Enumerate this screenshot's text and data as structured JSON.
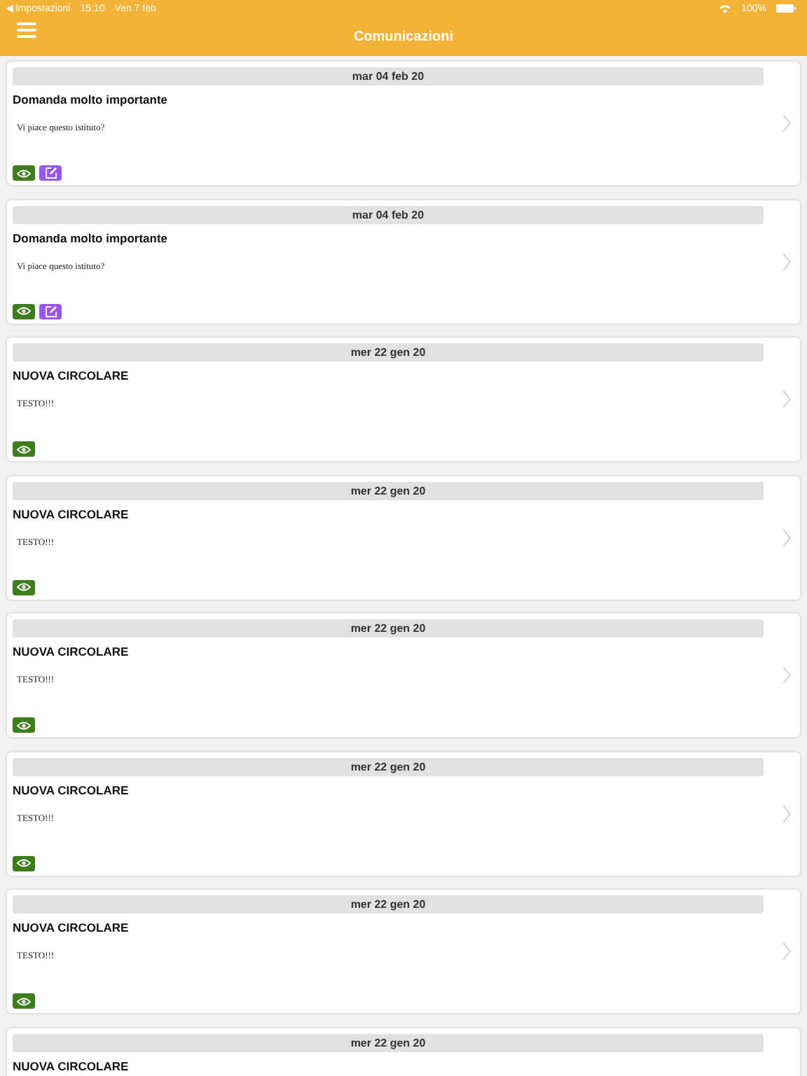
{
  "status_bar": {
    "back_label": "◀ Impostazioni",
    "time": "15:10",
    "date": "Ven 7 feb",
    "battery": "100%"
  },
  "header": {
    "title": "Comunicazioni"
  },
  "cards": [
    {
      "date": "mar 04 feb 20",
      "title": "Domanda molto importante",
      "body": "Vi piace questo istituto?",
      "actions": [
        {
          "kind": "view"
        },
        {
          "kind": "edit"
        }
      ]
    },
    {
      "date": "mar 04 feb 20",
      "title": "Domanda molto importante",
      "body": "Vi piace questo istituto?",
      "actions": [
        {
          "kind": "view"
        },
        {
          "kind": "edit"
        }
      ]
    },
    {
      "date": "mer 22 gen 20",
      "title": "NUOVA CIRCOLARE",
      "body": "TESTO!!!",
      "actions": [
        {
          "kind": "view"
        }
      ]
    },
    {
      "date": "mer 22 gen 20",
      "title": "NUOVA CIRCOLARE",
      "body": "TESTO!!!",
      "actions": [
        {
          "kind": "view"
        }
      ]
    },
    {
      "date": "mer 22 gen 20",
      "title": "NUOVA CIRCOLARE",
      "body": "TESTO!!!",
      "actions": [
        {
          "kind": "view"
        }
      ]
    },
    {
      "date": "mer 22 gen 20",
      "title": "NUOVA CIRCOLARE",
      "body": "TESTO!!!",
      "actions": [
        {
          "kind": "view"
        }
      ]
    },
    {
      "date": "mer 22 gen 20",
      "title": "NUOVA CIRCOLARE",
      "body": "TESTO!!!",
      "actions": [
        {
          "kind": "view"
        }
      ]
    },
    {
      "date": "mer 22 gen 20",
      "title": "NUOVA CIRCOLARE"
    }
  ]
}
